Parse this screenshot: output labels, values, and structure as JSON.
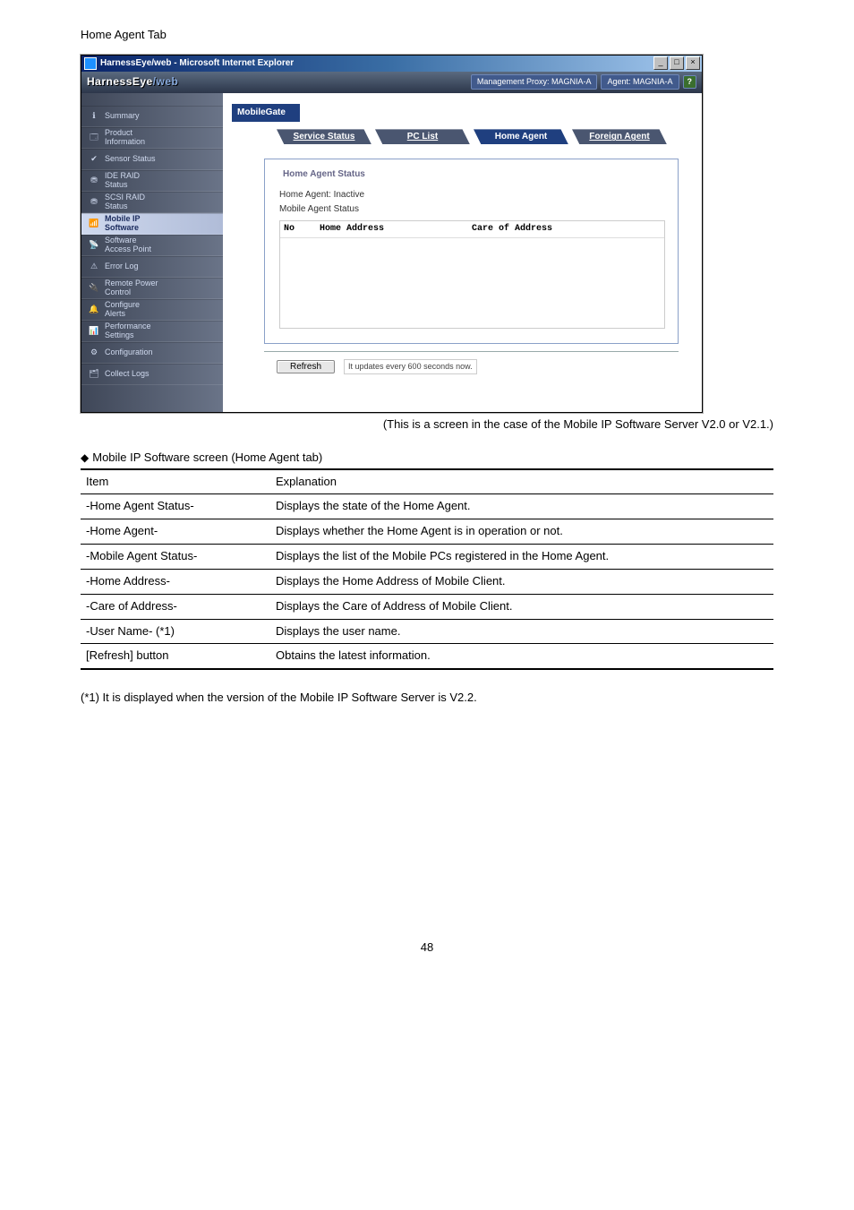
{
  "heading": "Home Agent Tab",
  "ie": {
    "title": "HarnessEye/web - Microsoft Internet Explorer",
    "min": "_",
    "max": "□",
    "close": "×"
  },
  "banner": {
    "logo_main": "HarnessEye",
    "logo_sub": "/web",
    "proxy_pill": "Management Proxy: MAGNIA-A",
    "agent_pill": "Agent: MAGNIA-A",
    "help": "?"
  },
  "sidebar": [
    {
      "icon": "ℹ",
      "label": "Summary",
      "name": "sidebar-item-summary"
    },
    {
      "icon": "🗔",
      "label": "Product\nInformation",
      "name": "sidebar-item-product-information"
    },
    {
      "icon": "✔",
      "label": "Sensor Status",
      "name": "sidebar-item-sensor-status"
    },
    {
      "icon": "⛃",
      "label": "IDE RAID\nStatus",
      "name": "sidebar-item-ide-raid-status"
    },
    {
      "icon": "⛃",
      "label": "SCSI RAID\nStatus",
      "name": "sidebar-item-scsi-raid-status"
    },
    {
      "icon": "📶",
      "label": "Mobile IP\nSoftware",
      "name": "sidebar-item-mobile-ip-software",
      "selected": true
    },
    {
      "icon": "📡",
      "label": "Software\nAccess Point",
      "name": "sidebar-item-software-access-point"
    },
    {
      "icon": "⚠",
      "label": "Error Log",
      "name": "sidebar-item-error-log"
    },
    {
      "icon": "🔌",
      "label": "Remote Power\nControl",
      "name": "sidebar-item-remote-power-control"
    },
    {
      "icon": "🔔",
      "label": "Configure\nAlerts",
      "name": "sidebar-item-configure-alerts"
    },
    {
      "icon": "📊",
      "label": "Performance\nSettings",
      "name": "sidebar-item-performance-settings"
    },
    {
      "icon": "⚙",
      "label": "Configuration",
      "name": "sidebar-item-configuration"
    },
    {
      "icon": "🗂",
      "label": "Collect Logs",
      "name": "sidebar-item-collect-logs"
    }
  ],
  "module": {
    "title": "MobileGate",
    "tabs": {
      "service_status": "Service Status",
      "pc_list": "PC List",
      "home_agent": "Home Agent",
      "foreign_agent": "Foreign Agent"
    },
    "fieldset_legend": "Home Agent Status",
    "home_agent_line": "Home Agent:  Inactive",
    "mas_line": "Mobile Agent Status",
    "col_no": "No",
    "col_home_address": "Home Address",
    "col_care_of_address": "Care of Address",
    "refresh_label": "Refresh",
    "update_note": "It updates every 600 seconds now."
  },
  "caption": "(This is a screen in the case of the Mobile IP Software Server V2.0 or V2.1.)",
  "table_title": "Mobile IP Software screen (Home Agent tab)",
  "table": {
    "header_item": "Item",
    "header_expl": "Explanation",
    "rows": [
      {
        "item": "-Home Agent Status-",
        "expl": "Displays the state of the Home Agent."
      },
      {
        "item": "-Home Agent-",
        "expl": "Displays whether the Home Agent is in operation or not."
      },
      {
        "item": "-Mobile Agent Status-",
        "expl": "Displays the list of the Mobile PCs registered in the Home Agent."
      },
      {
        "item": "-Home Address-",
        "expl": "Displays the Home Address of Mobile Client."
      },
      {
        "item": "-Care of Address-",
        "expl": "Displays the Care of Address of Mobile Client."
      },
      {
        "item": "-User Name- (*1)",
        "expl": "Displays the user name."
      },
      {
        "item": "[Refresh] button",
        "expl": "Obtains the latest information."
      }
    ]
  },
  "note": "(*1) It is displayed when the version of the Mobile IP Software Server is V2.2.",
  "pagenum": "48"
}
